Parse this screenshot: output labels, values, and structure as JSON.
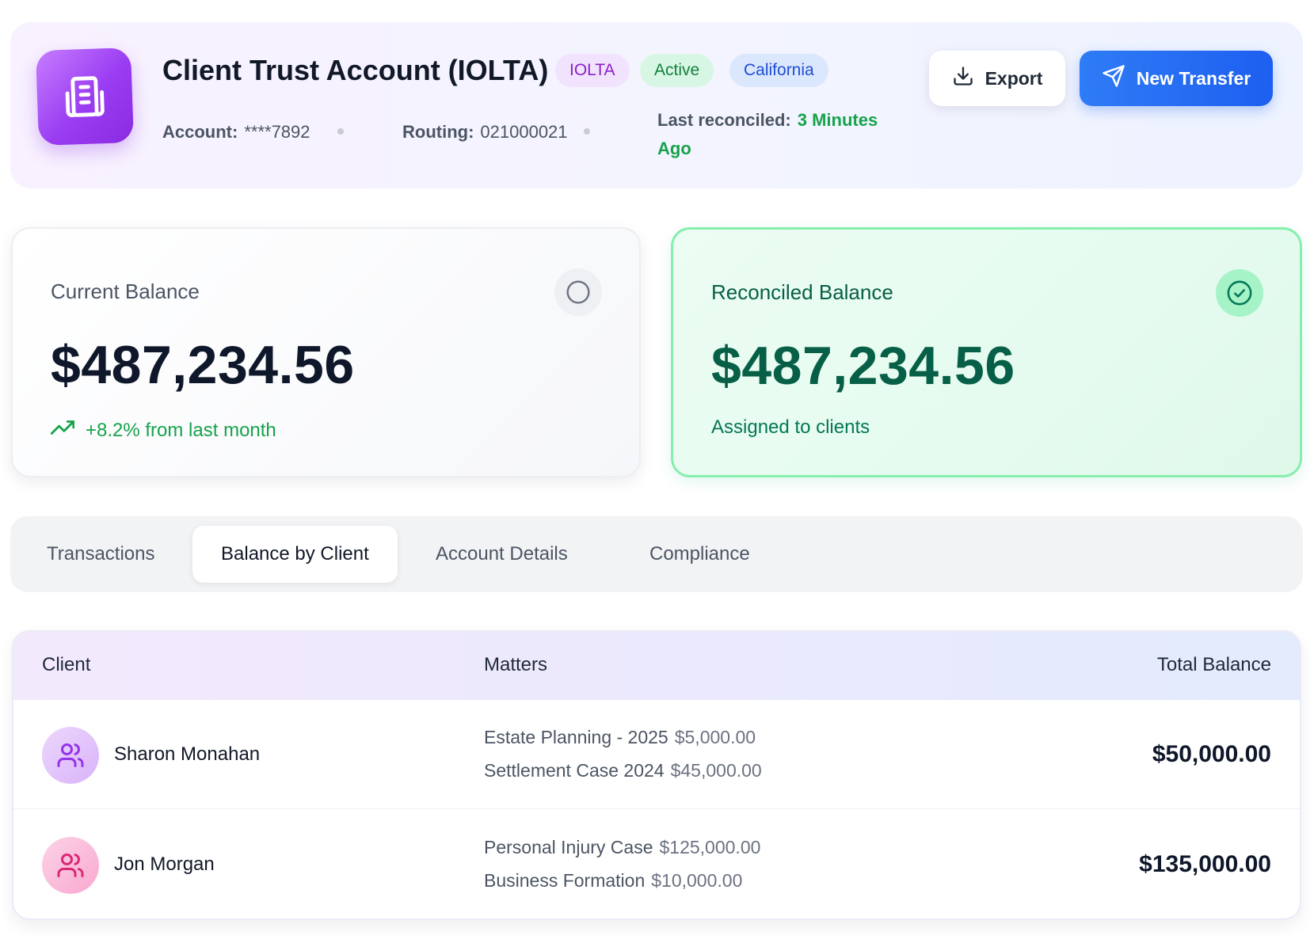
{
  "header": {
    "title": "Client Trust Account (IOLTA)",
    "badges": {
      "type": "IOLTA",
      "status": "Active",
      "state": "California"
    },
    "account_label": "Account:",
    "account_value": "****7892",
    "routing_label": "Routing:",
    "routing_value": "021000021",
    "reconciled_label": "Last reconciled:",
    "reconciled_value": "3 Minutes Ago",
    "export_label": "Export",
    "transfer_label": "New Transfer",
    "icons": {
      "app": "building-icon",
      "export": "download-icon",
      "transfer": "send-icon"
    }
  },
  "cards": {
    "current": {
      "label": "Current Balance",
      "amount": "$487,234.56",
      "sub": "+8.2% from last month",
      "icon": "circle-icon",
      "trend_icon": "trending-up-icon"
    },
    "reconciled": {
      "label": "Reconciled Balance",
      "amount": "$487,234.56",
      "sub": "Assigned to clients",
      "icon": "check-circle-icon"
    }
  },
  "tabs": [
    {
      "label": "Transactions",
      "active": false
    },
    {
      "label": "Balance by Client",
      "active": true
    },
    {
      "label": "Account Details",
      "active": false
    },
    {
      "label": "Compliance",
      "active": false
    }
  ],
  "table": {
    "headers": {
      "client": "Client",
      "matters": "Matters",
      "total": "Total Balance"
    },
    "rows": [
      {
        "name": "Sharon Monahan",
        "icon": "users-icon",
        "matters": [
          {
            "name": "Estate Planning - 2025",
            "amount": "$5,000.00"
          },
          {
            "name": "Settlement Case 2024",
            "amount": "$45,000.00"
          }
        ],
        "total": "$50,000.00"
      },
      {
        "name": "Jon Morgan",
        "icon": "users-icon",
        "matters": [
          {
            "name": "Personal Injury Case",
            "amount": "$125,000.00"
          },
          {
            "name": "Business Formation",
            "amount": "$10,000.00"
          }
        ],
        "total": "$135,000.00"
      }
    ]
  },
  "colors": {
    "primary": "#2563eb",
    "success": "#16a34a",
    "iolta_badge": "#8a22c7",
    "app_icon": "#9a3cf2"
  }
}
